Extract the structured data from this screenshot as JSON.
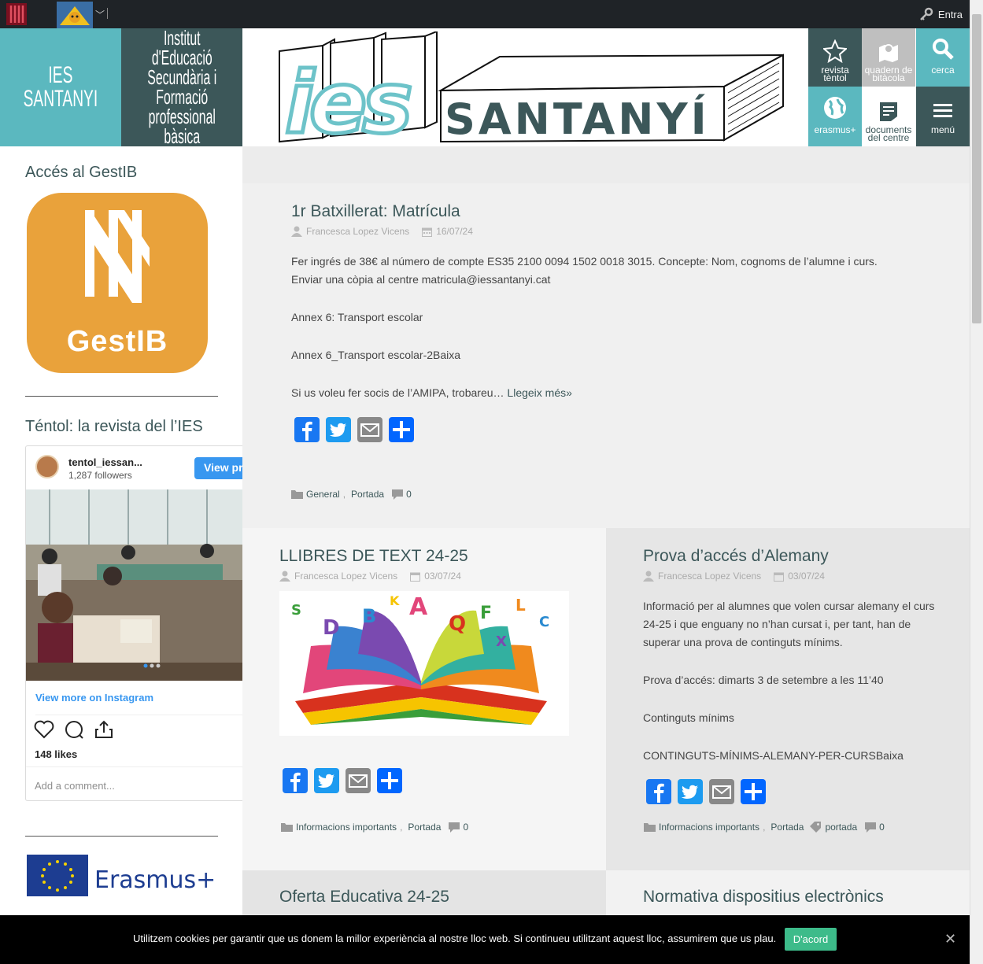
{
  "admin_bar": {
    "login_label": "Entra"
  },
  "brand": {
    "short_name_line1": "IES",
    "short_name_line2": "SANTANYI",
    "long_name_lines": [
      "Institut",
      "d'Educació",
      "Secundària i",
      "Formació",
      "professional",
      "bàsica"
    ]
  },
  "banner": {
    "logo_ies": "ies",
    "logo_santanyi": "SANTANYÍ"
  },
  "tiles": [
    {
      "label_line1": "revista",
      "label_line2": "tèntol",
      "icon": "star-icon"
    },
    {
      "label_line1": "quadern de",
      "label_line2": "bitàcola",
      "icon": "map-icon"
    },
    {
      "label_line1": "cerca",
      "label_line2": "",
      "icon": "search-icon"
    },
    {
      "label_line1": "erasmus+",
      "label_line2": "",
      "icon": "globe-icon"
    },
    {
      "label_line1": "documents",
      "label_line2": "del centre",
      "icon": "document-icon"
    },
    {
      "label_line1": "menú",
      "label_line2": "",
      "icon": "menu-icon"
    }
  ],
  "sidebar": {
    "gestib_title": "Accés al GestIB",
    "gestib_logo_text": "GestIB",
    "revista_title": "Téntol: la revista del l’IES",
    "instagram": {
      "username": "tentol_iessan...",
      "followers": "1,287 followers",
      "view_profile": "View pr",
      "view_more": "View more on Instagram",
      "likes": "148 likes",
      "add_comment": "Add a comment..."
    },
    "erasmus_text": "Erasmus+"
  },
  "posts": [
    {
      "title": "1r Batxillerat: Matrícula",
      "author": "Francesca Lopez Vicens",
      "date": "16/07/24",
      "paragraphs": [
        "Fer ingrés de 38€ al número de compte ES35 2100 0094 1502 0018 3015. Concepte: Nom, cognoms de l’alumne i curs.",
        "Enviar una còpia al centre matricula@iessantanyi.cat",
        "Annex 6: Transport escolar",
        "Annex 6_Transport escolar-2Baixa",
        "Si us voleu fer socis de l’AMIPA, trobareu…"
      ],
      "read_more": "Llegeix més»",
      "categories": [
        "General",
        "Portada"
      ],
      "comments": "0"
    },
    {
      "title": "LLIBRES DE TEXT 24-25",
      "author": "Francesca Lopez Vicens",
      "date": "03/07/24",
      "categories": [
        "Informacions importants",
        "Portada"
      ],
      "comments": "0"
    },
    {
      "title": "Prova d’accés d’Alemany",
      "author": "Francesca Lopez Vicens",
      "date": "03/07/24",
      "paragraphs": [
        "Informació per al alumnes que volen cursar alemany el curs 24-25 i que enguany no n’han cursat i, per tant, han de superar una prova de continguts mínims.",
        "Prova d’accés: dimarts 3 de setembre a les 11’40",
        "Continguts mínims",
        "CONTINGUTS-MÍNIMS-ALEMANY-PER-CURSBaixa"
      ],
      "categories": [
        "Informacions importants",
        "Portada"
      ],
      "tag": "portada",
      "comments": "0"
    },
    {
      "title": "Oferta Educativa 24-25"
    },
    {
      "title": "Normativa dispositius electrònics"
    }
  ],
  "cookie": {
    "text": "Utilitzem cookies per garantir que us donem la millor experiència al nostre lloc web. Si continueu utilitzant aquest lloc, assumirem que us plau.",
    "accept": "D'acord",
    "close": "✕"
  },
  "colors": {
    "teal": "#5bb8bf",
    "dark_teal": "#3c5759",
    "gestib_orange": "#e9a23b",
    "cookie_green": "#3dbb8a"
  }
}
